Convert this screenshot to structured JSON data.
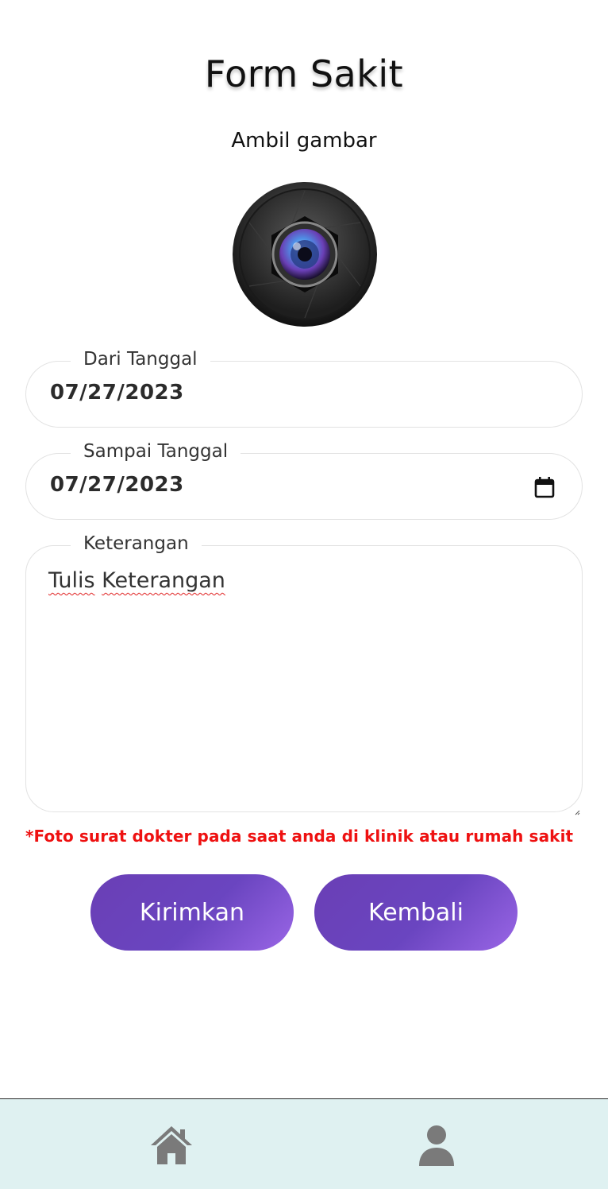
{
  "header": {
    "title": "Form Sakit",
    "subtitle": "Ambil gambar"
  },
  "camera": {
    "icon": "camera-lens-icon"
  },
  "form": {
    "from_date": {
      "label": "Dari Tanggal",
      "value": "07/27/2023"
    },
    "to_date": {
      "label": "Sampai Tanggal",
      "value": "07/27/2023",
      "icon": "calendar-icon"
    },
    "notes": {
      "label": "Keterangan",
      "value_word1": "Tulis",
      "value_word2": "Keterangan"
    },
    "warning": "*Foto surat dokter pada saat anda di klinik atau rumah sakit"
  },
  "actions": {
    "submit_label": "Kirimkan",
    "back_label": "Kembali"
  },
  "bottom_nav": {
    "items": [
      {
        "name": "home",
        "icon": "home-icon"
      },
      {
        "name": "profile",
        "icon": "user-icon"
      }
    ]
  },
  "colors": {
    "accent_start": "#6a3fb5",
    "accent_end": "#9a66e6",
    "warning": "#ee1111",
    "nav_bg": "#dff1f1",
    "nav_icon": "#7a7a7a"
  }
}
